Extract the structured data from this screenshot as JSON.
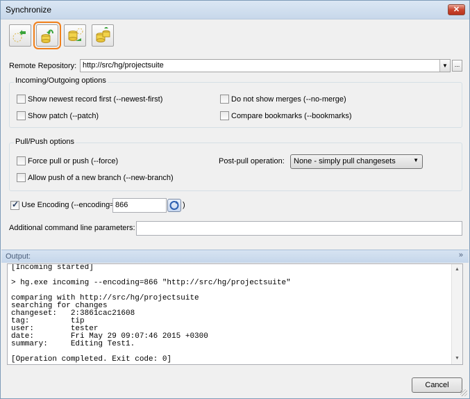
{
  "window": {
    "title": "Synchronize",
    "close_label": "✕"
  },
  "toolbar": {
    "buttons": [
      {
        "name": "pull-button",
        "icon": "pull-icon",
        "active": false
      },
      {
        "name": "incoming-button",
        "icon": "incoming-icon",
        "active": true
      },
      {
        "name": "outgoing-button",
        "icon": "outgoing-icon",
        "active": false
      },
      {
        "name": "push-button",
        "icon": "push-icon",
        "active": false
      }
    ]
  },
  "remote": {
    "label": "Remote Repository:",
    "value": "http://src/hg/projectsuite",
    "browse_label": "..."
  },
  "incoming_outgoing": {
    "title": "Incoming/Outgoing options",
    "newest_first": {
      "label": "Show newest record first (--newest-first)",
      "checked": false
    },
    "show_patch": {
      "label": "Show patch (--patch)",
      "checked": false
    },
    "no_merges": {
      "label": "Do not show merges (--no-merge)",
      "checked": false
    },
    "compare_bookmarks": {
      "label": "Compare bookmarks (--bookmarks)",
      "checked": false
    }
  },
  "pull_push": {
    "title": "Pull/Push options",
    "force": {
      "label": "Force pull or push (--force)",
      "checked": false
    },
    "new_branch": {
      "label": "Allow push of a new branch (--new-branch)",
      "checked": false
    },
    "post_pull_label": "Post-pull operation:",
    "post_pull_value": "None - simply pull changesets"
  },
  "encoding": {
    "label": "Use Encoding (--encoding=",
    "checked": true,
    "value": "866",
    "close_paren": ")"
  },
  "additional": {
    "label": "Additional command line parameters:",
    "value": ""
  },
  "output": {
    "header": "Output:",
    "collapse_icon": "»",
    "text": "[Incoming started]\n\n> hg.exe incoming --encoding=866 \"http://src/hg/projectsuite\"\n\ncomparing with http://src/hg/projectsuite\nsearching for changes\nchangeset:   2:3861cac21608\ntag:         tip\nuser:        tester\ndate:        Fri May 29 09:07:46 2015 +0300\nsummary:     Editing Test1.\n\n[Operation completed. Exit code: 0]"
  },
  "footer": {
    "cancel_label": "Cancel"
  },
  "colors": {
    "accent": "#f07f1a",
    "titlebar": "#c7d7ea",
    "close": "#c9452f"
  }
}
